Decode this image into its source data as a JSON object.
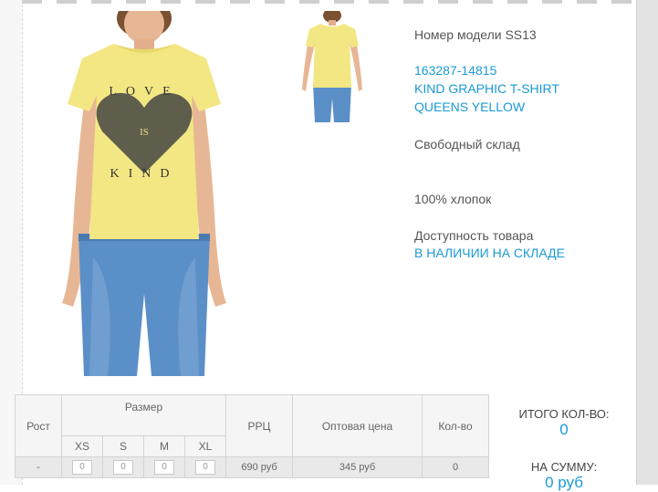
{
  "product": {
    "model_label": "Номер модели SS13",
    "article": "163287-14815",
    "name": "KIND GRAPHIC T-SHIRT",
    "color": "QUEENS YELLOW",
    "stock_type": "Свободный склад",
    "composition": "100% хлопок",
    "availability_label": "Доступность товара",
    "availability_status": "В НАЛИЧИИ НА СКЛАДЕ",
    "print_text": [
      "LOVE",
      "IS",
      "KIND"
    ]
  },
  "table": {
    "header": {
      "height": "Рост",
      "size": "Размер",
      "rrp": "РРЦ",
      "wholesale": "Оптовая цена",
      "qty": "Кол-во"
    },
    "sizes": [
      "XS",
      "S",
      "M",
      "XL"
    ],
    "row": {
      "height": "-",
      "qty_values": [
        "0",
        "0",
        "0",
        "0"
      ],
      "rrp": "690 руб",
      "wholesale": "345 руб",
      "qty": "0"
    }
  },
  "totals": {
    "qty_label": "ИТОГО КОЛ-ВО:",
    "qty_value": "0",
    "sum_label": "НА СУММУ:",
    "sum_value": "0 руб"
  },
  "colors": {
    "link": "#1a9ad6",
    "shirt": "#f3e784",
    "jeans": "#5b8fc7"
  }
}
